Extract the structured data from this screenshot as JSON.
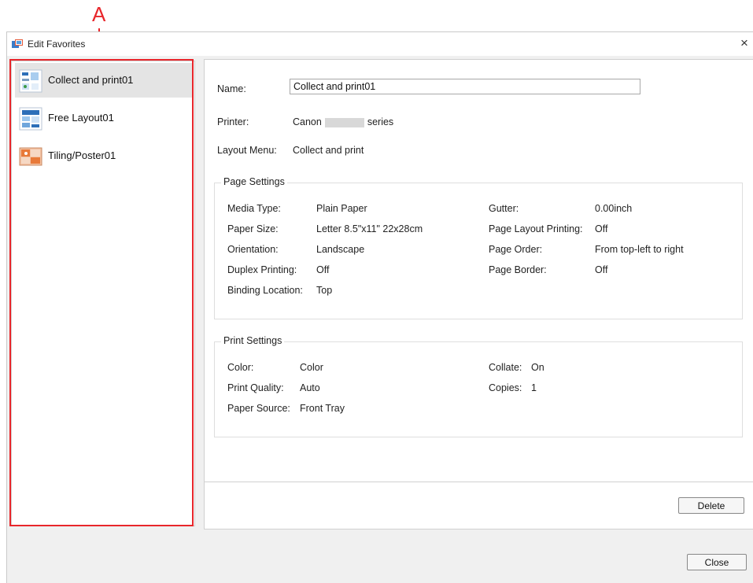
{
  "annotation": {
    "letter": "A"
  },
  "window": {
    "title": "Edit Favorites",
    "close_glyph": "×"
  },
  "favorites": [
    {
      "label": "Collect and print01",
      "icon": "collect-print-thumbnail",
      "selected": true
    },
    {
      "label": "Free Layout01",
      "icon": "free-layout-thumbnail",
      "selected": false
    },
    {
      "label": "Tiling/Poster01",
      "icon": "tiling-poster-thumbnail",
      "selected": false
    }
  ],
  "details": {
    "name_label": "Name:",
    "name_value": "Collect and print01",
    "printer_label": "Printer:",
    "printer_prefix": "Canon",
    "printer_suffix": "series",
    "layout_label": "Layout Menu:",
    "layout_value": "Collect and print"
  },
  "page_settings": {
    "title": "Page Settings",
    "left": [
      {
        "label": "Media Type:",
        "value": "Plain Paper"
      },
      {
        "label": "Paper Size:",
        "value": "Letter 8.5\"x11\" 22x28cm"
      },
      {
        "label": "Orientation:",
        "value": "Landscape"
      },
      {
        "label": "Duplex Printing:",
        "value": "Off"
      },
      {
        "label": "Binding Location:",
        "value": "Top"
      }
    ],
    "right": [
      {
        "label": "Gutter:",
        "value": "0.00inch"
      },
      {
        "label": "Page Layout Printing:",
        "value": "Off"
      },
      {
        "label": "Page Order:",
        "value": "From top-left to right"
      },
      {
        "label": "Page Border:",
        "value": "Off"
      }
    ]
  },
  "print_settings": {
    "title": "Print Settings",
    "left": [
      {
        "label": "Color:",
        "value": "Color"
      },
      {
        "label": "Print Quality:",
        "value": "Auto"
      },
      {
        "label": "Paper Source:",
        "value": "Front Tray"
      }
    ],
    "right": [
      {
        "label": "Collate:",
        "value": "On"
      },
      {
        "label": "Copies:",
        "value": "1"
      }
    ]
  },
  "buttons": {
    "delete": "Delete",
    "close": "Close"
  },
  "colors": {
    "highlight": "#e8262b",
    "selected_bg": "#e4e4e4"
  }
}
